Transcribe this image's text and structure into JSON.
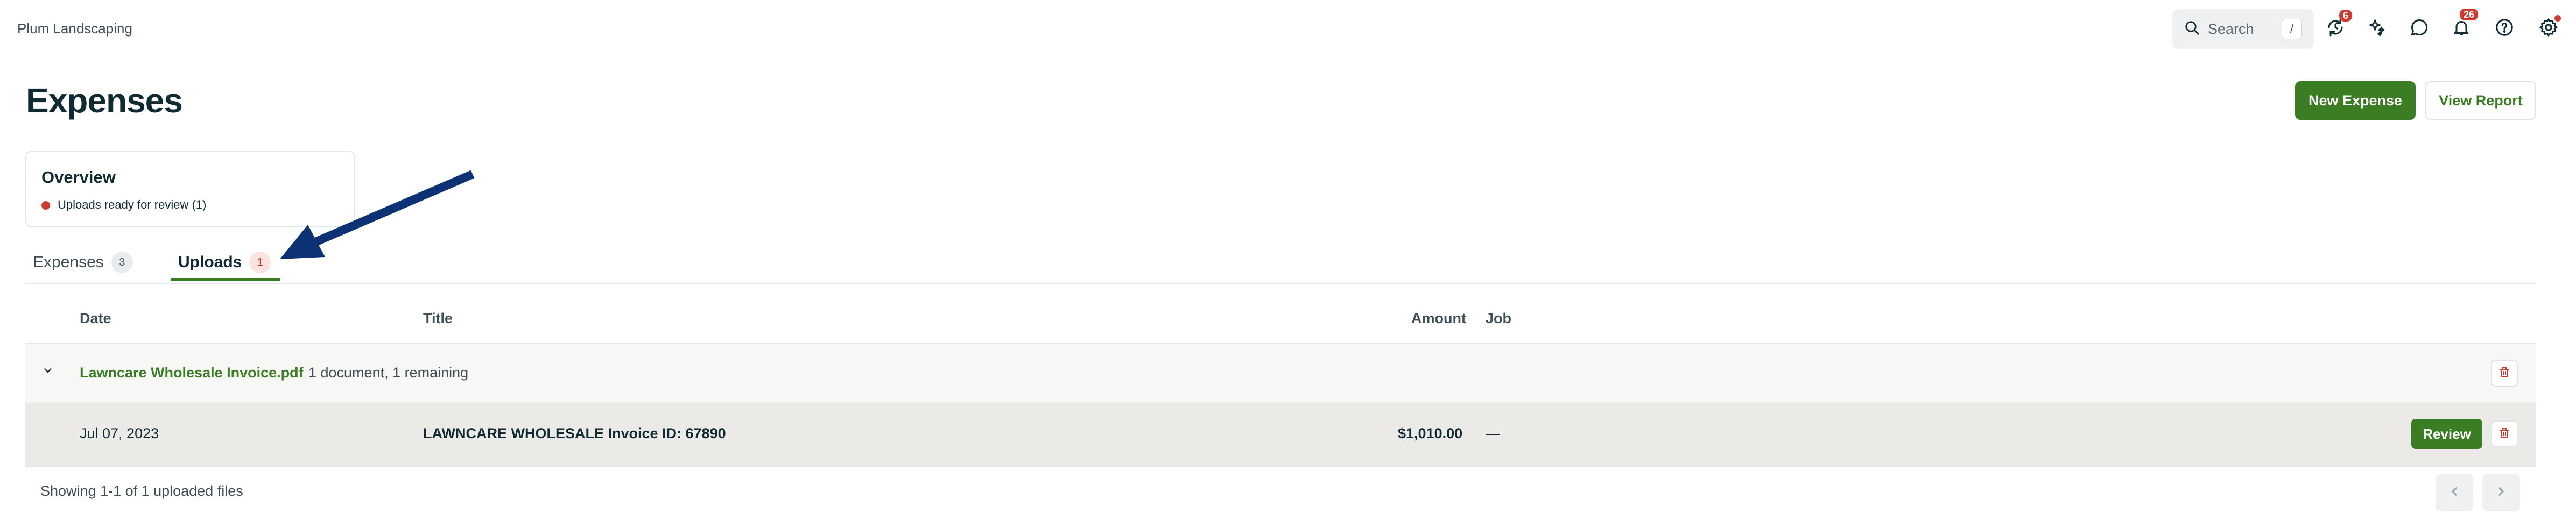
{
  "company": "Plum Landscaping",
  "search": {
    "label": "Search",
    "shortcut": "/"
  },
  "top_icons": [
    {
      "name": "sync-icon",
      "badge": "6"
    },
    {
      "name": "sparkle-icon",
      "badge": ""
    },
    {
      "name": "chat-icon",
      "badge": ""
    },
    {
      "name": "bell-icon",
      "badge": "26"
    },
    {
      "name": "help-icon",
      "badge": ""
    },
    {
      "name": "gear-icon",
      "badge": ""
    }
  ],
  "page": {
    "title": "Expenses",
    "new_button": "New Expense",
    "report_button": "View Report"
  },
  "overview": {
    "title": "Overview",
    "item": "Uploads ready for review (1)"
  },
  "tabs": [
    {
      "label": "Expenses",
      "count": "3",
      "active": false
    },
    {
      "label": "Uploads",
      "count": "1",
      "active": true
    }
  ],
  "table": {
    "headers": {
      "date": "Date",
      "title": "Title",
      "amount": "Amount",
      "job": "Job"
    },
    "group": {
      "filename": "Lawncare Wholesale Invoice.pdf",
      "info": "1 document, 1 remaining"
    },
    "rows": [
      {
        "date": "Jul 07, 2023",
        "title": "LAWNCARE WHOLESALE Invoice ID: 67890",
        "amount": "$1,010.00",
        "job": "—",
        "action": "Review"
      }
    ]
  },
  "footer": {
    "showing": "Showing 1-1 of 1 uploaded files"
  },
  "colors": {
    "brand_green": "#3b7d23",
    "badge_red": "#d03a2e",
    "arrow_navy": "#0c3275"
  }
}
